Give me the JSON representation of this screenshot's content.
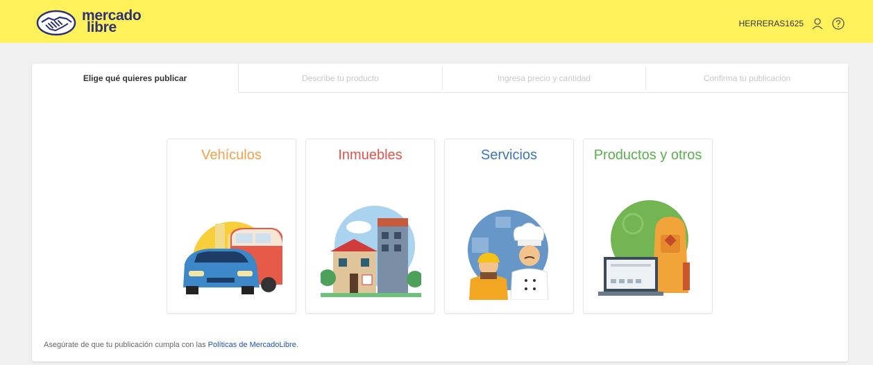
{
  "header": {
    "logo_line1": "mercado",
    "logo_line2": "libre",
    "username": "HERRERAS1625",
    "user_icon": "person-icon",
    "help_icon": "help-icon"
  },
  "steps": [
    {
      "label": "Elige qué quieres publicar",
      "active": true
    },
    {
      "label": "Describe tu producto",
      "active": false
    },
    {
      "label": "Ingresa precio y cantidad",
      "active": false
    },
    {
      "label": "Confirma tu publicación",
      "active": false
    }
  ],
  "categories": [
    {
      "title": "Vehículos",
      "color": "#f5a04a",
      "icon": "vehicles-illustration"
    },
    {
      "title": "Inmuebles",
      "color": "#e5524a",
      "icon": "real-estate-illustration"
    },
    {
      "title": "Servicios",
      "color": "#3c74b8",
      "icon": "services-illustration"
    },
    {
      "title": "Productos y otros",
      "color": "#5aae4b",
      "icon": "products-illustration"
    }
  ],
  "footer": {
    "text": "Asegúrate de que tu publicación cumpla con las ",
    "link": "Políticas de MercadoLibre",
    "end": "."
  },
  "colors": {
    "header_bg": "#fff159",
    "brand_text": "#2d3277"
  }
}
